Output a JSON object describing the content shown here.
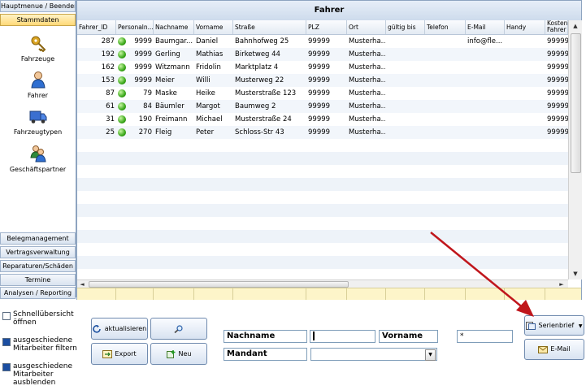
{
  "nav": {
    "top_button": "Hauptmenue / Beenden",
    "active_section": "Stammdaten",
    "items": [
      {
        "label": "Fahrzeuge",
        "icon": "keys-icon"
      },
      {
        "label": "Fahrer",
        "icon": "person-icon"
      },
      {
        "label": "Fahrzeugtypen",
        "icon": "truck-icon"
      },
      {
        "label": "Geschäftspartner",
        "icon": "people-icon"
      }
    ],
    "bottom_sections": [
      "Belegmanagement",
      "Vertragsverwaltung",
      "Reparaturen/Schäden",
      "Termine",
      "Analysen / Reporting"
    ]
  },
  "grid": {
    "title": "Fahrer",
    "columns": [
      "Fahrer_ID",
      "Personaln...",
      "Nachname",
      "Vorname",
      "Straße",
      "PLZ",
      "Ort",
      "gültig bis",
      "Telefon",
      "E-Mail",
      "Handy",
      "Kostenst Fahrer"
    ],
    "rows": [
      {
        "id": "287",
        "pnr": "9999",
        "nachname": "Baumgar...",
        "vorname": "Daniel",
        "strasse": "Bahnhofweg 25",
        "plz": "99999",
        "ort": "Musterha...",
        "email": "info@fle...",
        "kst": "99999"
      },
      {
        "id": "192",
        "pnr": "9999",
        "nachname": "Gerling",
        "vorname": "Mathias",
        "strasse": "Birketweg 44",
        "plz": "99999",
        "ort": "Musterha...",
        "email": "",
        "kst": "99999"
      },
      {
        "id": "162",
        "pnr": "9999",
        "nachname": "Witzmann",
        "vorname": "Fridolin",
        "strasse": "Marktplatz 4",
        "plz": "99999",
        "ort": "Musterha...",
        "email": "",
        "kst": "99999"
      },
      {
        "id": "153",
        "pnr": "9999",
        "nachname": "Meier",
        "vorname": "Willi",
        "strasse": "Musterweg 22",
        "plz": "99999",
        "ort": "Musterha...",
        "email": "",
        "kst": "99999"
      },
      {
        "id": "87",
        "pnr": "79",
        "nachname": "Maske",
        "vorname": "Heike",
        "strasse": "Musterstraße 123",
        "plz": "99999",
        "ort": "Musterha...",
        "email": "",
        "kst": "99999"
      },
      {
        "id": "61",
        "pnr": "84",
        "nachname": "Bäumler",
        "vorname": "Margot",
        "strasse": "Baumweg 2",
        "plz": "99999",
        "ort": "Musterha...",
        "email": "",
        "kst": "99999"
      },
      {
        "id": "31",
        "pnr": "190",
        "nachname": "Freimann",
        "vorname": "Michael",
        "strasse": "Musterstraße 24",
        "plz": "99999",
        "ort": "Musterha...",
        "email": "",
        "kst": "99999"
      },
      {
        "id": "25",
        "pnr": "270",
        "nachname": "Fleig",
        "vorname": "Peter",
        "strasse": "Schloss-Str 43",
        "plz": "99999",
        "ort": "Musterha...",
        "email": "",
        "kst": "99999"
      }
    ]
  },
  "options": {
    "schnell": "Schnellübersicht öffnen",
    "filtern": "ausgeschiedene Mitarbeiter filtern",
    "ausblenden": "ausgeschiedene Mitarbeiter ausblenden"
  },
  "buttons": {
    "aktualisieren": "aktualisieren",
    "export": "Export",
    "neu": "Neu",
    "serienbrief": "Serienbrief",
    "email": "E-Mail"
  },
  "filters": {
    "nachname_label": "Nachname",
    "nachname_value": "",
    "vorname_label": "Vorname",
    "vorname_value": "*",
    "mandant_label": "Mandant",
    "mandant_value": ""
  },
  "colors": {
    "status_active": "#3aa81a",
    "annotation_arrow": "#c0161c",
    "footer_row": "#fdf5c9"
  }
}
